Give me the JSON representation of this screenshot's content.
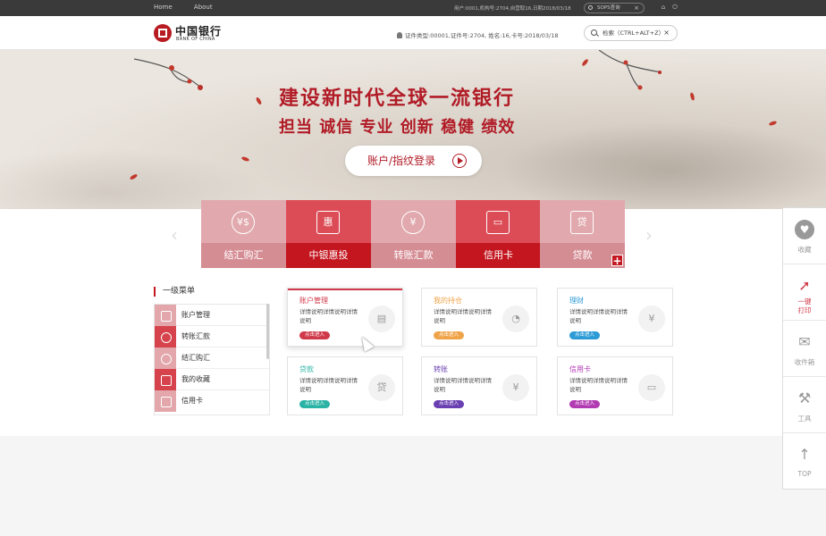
{
  "topbar": {
    "nav": [
      "Home",
      "About"
    ],
    "user_info": "用户:0001,机构号:2704,自营取16,日期2018/03/18",
    "sop_search": "SOPS查询"
  },
  "header": {
    "logo_cn": "中国银行",
    "logo_en": "BANK OF CHINA",
    "info": "证件类型:00001,证件号:2704,    姓名:16,卡号:2018/03/18",
    "search_label": "检索（CTRL+ALT+Z）"
  },
  "banner": {
    "title": "建设新时代全球一流银行",
    "subtitle": "担当 诚信 专业 创新 稳健 绩效",
    "login_label": "账户/指纹登录"
  },
  "tiles": [
    {
      "label": "结汇购汇",
      "icon": "exchange-icon",
      "glyph": "¥$",
      "style": "light"
    },
    {
      "label": "中银惠投",
      "icon": "invest-icon",
      "glyph": "惠",
      "style": "dark"
    },
    {
      "label": "转账汇款",
      "icon": "transfer-icon",
      "glyph": "¥",
      "style": "light"
    },
    {
      "label": "信用卡",
      "icon": "credit-card-icon",
      "glyph": "▭",
      "style": "dark"
    },
    {
      "label": "贷款",
      "icon": "loan-icon",
      "glyph": "贷",
      "style": "light"
    }
  ],
  "menu": {
    "title": "一级菜单",
    "items": [
      "账户管理",
      "转账汇款",
      "结汇购汇",
      "我的收藏",
      "信用卡"
    ]
  },
  "cards": [
    {
      "title": "账户管理",
      "desc": "详情说明详情说明详情说明",
      "button": "点击进入",
      "color": "#d0394a",
      "glyph": "▤"
    },
    {
      "title": "我的持仓",
      "desc": "详情说明详情说明详情说明",
      "button": "点击进入",
      "color": "#f0a44a",
      "glyph": "◔"
    },
    {
      "title": "理财",
      "desc": "详情说明详情说明详情说明",
      "button": "点击进入",
      "color": "#2c9bd6",
      "glyph": "¥"
    },
    {
      "title": "贷款",
      "desc": "详情说明详情说明详情说明",
      "button": "点击进入",
      "color": "#2bb3a6",
      "glyph": "贷"
    },
    {
      "title": "转账",
      "desc": "详情说明详情说明详情说明",
      "button": "点击进入",
      "color": "#6a3fb1",
      "glyph": "¥"
    },
    {
      "title": "信用卡",
      "desc": "详情说明详情说明详情说明",
      "button": "点击进入",
      "color": "#b23ab3",
      "glyph": "▭"
    }
  ],
  "rail": [
    {
      "label": "收藏",
      "icon": "heart-icon"
    },
    {
      "label": "一键打印",
      "icon": "cursor-icon"
    },
    {
      "label": "收件箱",
      "icon": "mail-icon"
    },
    {
      "label": "工具",
      "icon": "tools-icon"
    },
    {
      "label": "TOP",
      "icon": "arrow-up-icon"
    }
  ]
}
